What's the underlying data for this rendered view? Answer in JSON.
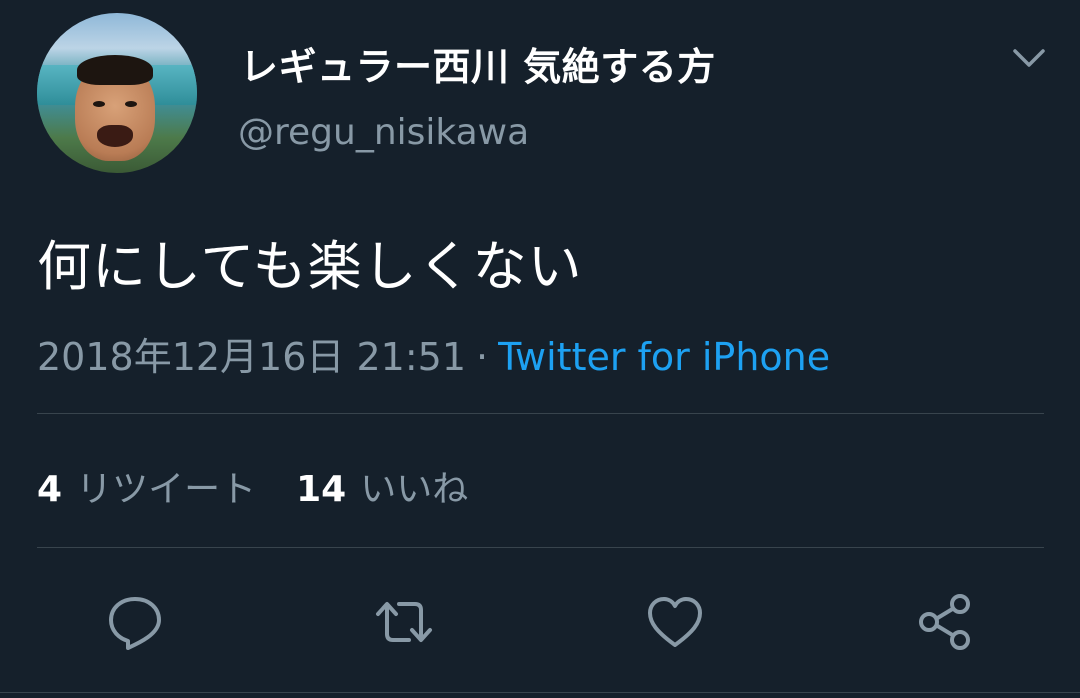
{
  "user": {
    "display_name": "レギュラー西川 気絶する方",
    "handle": "@regu_nisikawa"
  },
  "tweet": {
    "text": "何にしても楽しくない",
    "timestamp": "2018年12月16日 21:51",
    "separator": "·",
    "source": "Twitter for iPhone"
  },
  "stats": {
    "retweets_count": "4",
    "retweets_label": "リツイート",
    "likes_count": "14",
    "likes_label": "いいね"
  },
  "icons": {
    "menu": "chevron-down-icon",
    "reply": "reply-icon",
    "retweet": "retweet-icon",
    "like": "heart-icon",
    "share": "share-icon"
  },
  "colors": {
    "background": "#15202b",
    "primary_text": "#ffffff",
    "secondary_text": "#8899a6",
    "link": "#1da1f2",
    "divider": "#38444d"
  }
}
